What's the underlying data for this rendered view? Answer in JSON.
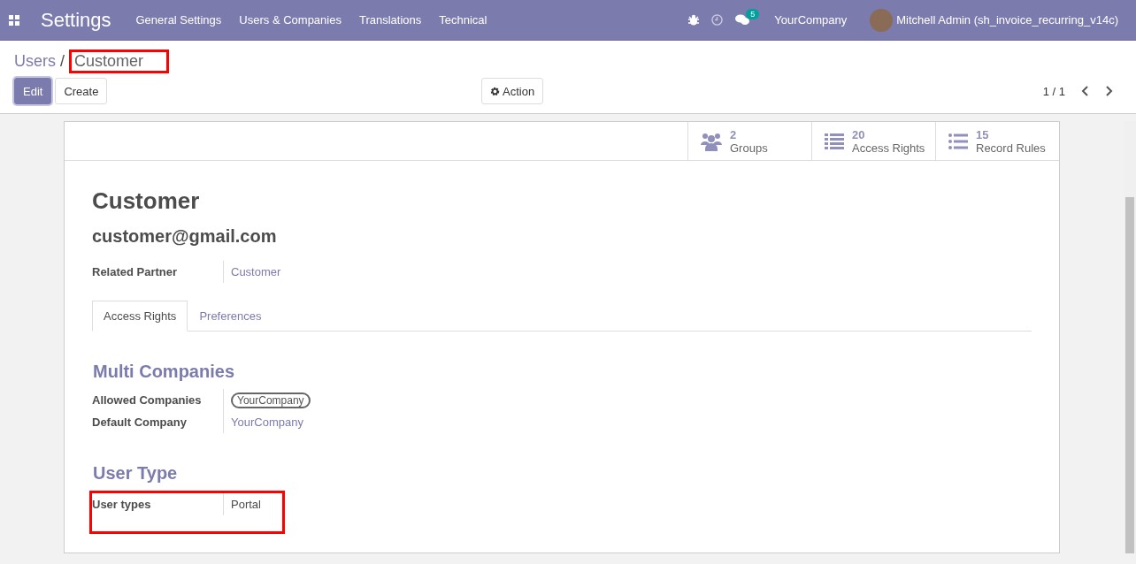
{
  "navbar": {
    "app_title": "Settings",
    "menus": [
      "General Settings",
      "Users & Companies",
      "Translations",
      "Technical"
    ],
    "messages_badge": "5",
    "company": "YourCompany",
    "user": "Mitchell Admin (sh_invoice_recurring_v14c)"
  },
  "breadcrumb": {
    "parent": "Users",
    "separator": "/",
    "current": "Customer"
  },
  "buttons": {
    "edit": "Edit",
    "create": "Create",
    "action": "Action"
  },
  "pager": "1 / 1",
  "smart_buttons": [
    {
      "kind": "groups",
      "count": "2",
      "label": "Groups"
    },
    {
      "kind": "list",
      "count": "20",
      "label": "Access Rights"
    },
    {
      "kind": "bullets",
      "count": "15",
      "label": "Record Rules"
    }
  ],
  "record": {
    "name": "Customer",
    "login": "customer@gmail.com",
    "related_partner_label": "Related Partner",
    "related_partner": "Customer"
  },
  "tabs": [
    {
      "label": "Access Rights",
      "selected": true
    },
    {
      "label": "Preferences",
      "selected": false
    }
  ],
  "sections": [
    {
      "title": "Multi Companies",
      "fields": [
        {
          "kind": "tags",
          "label": "Allowed Companies",
          "value": "YourCompany"
        },
        {
          "kind": "link",
          "label": "Default Company",
          "value": "YourCompany"
        }
      ]
    },
    {
      "title": "User Type",
      "fields": [
        {
          "kind": "text",
          "label": "User types",
          "value": "Portal"
        }
      ]
    }
  ]
}
